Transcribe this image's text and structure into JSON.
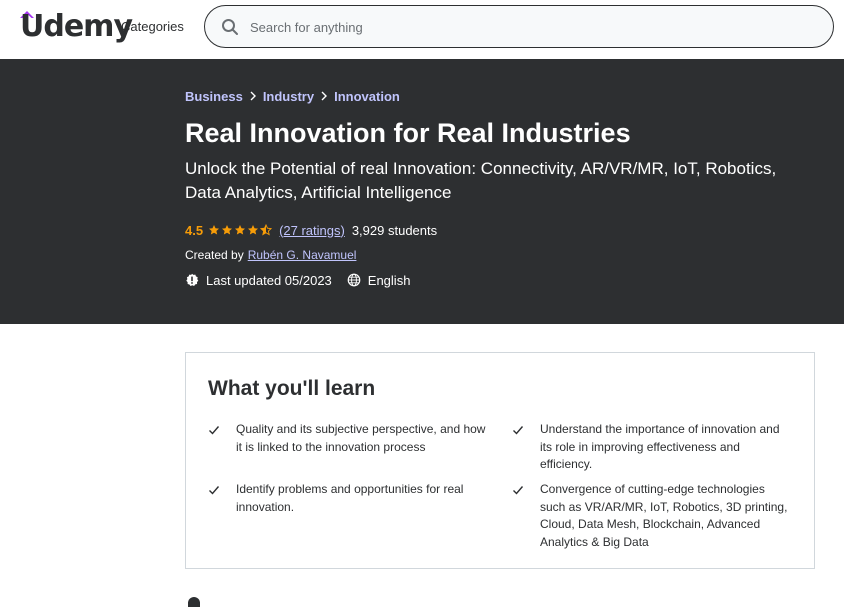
{
  "brand": {
    "name": "Udemy",
    "accent_color": "#a435f0"
  },
  "header": {
    "categories_label": "Categories",
    "search": {
      "placeholder": "Search for anything",
      "value": ""
    }
  },
  "course": {
    "breadcrumbs": [
      "Business",
      "Industry",
      "Innovation"
    ],
    "title": "Real Innovation for Real Industries",
    "subtitle": "Unlock the Potential of real Innovation: Connectivity, AR/VR/MR, IoT, Robotics, Data Analytics, Artificial Intelligence",
    "rating": "4.5",
    "rating_stars_value": 4.5,
    "ratings_count": "(27 ratings)",
    "students": "3,929 students",
    "created_by_label": "Created by",
    "creator": "Rubén G. Navamuel",
    "last_updated": "Last updated 05/2023",
    "language": "English"
  },
  "learn": {
    "title": "What you'll learn",
    "items": [
      "Quality and its subjective perspective, and how it is linked to the innovation process",
      "Understand the importance of innovation and its role in improving effectiveness and efficiency.",
      "Identify problems and opportunities for real innovation.",
      "Convergence of cutting-edge technologies such as VR/AR/MR, IoT, Robotics, 3D printing, Cloud, Data Mesh, Blockchain, Advanced Analytics & Big Data"
    ]
  },
  "colors": {
    "hero_background": "#2d2f31",
    "link": "#c0c4fc",
    "rating": "#f69c08",
    "text": "#2d2f31",
    "border": "#d1d7dc"
  },
  "icons": {
    "search": "search-icon",
    "chevron": "chevron-right-icon",
    "star": "star-icon",
    "update": "alert-badge-icon",
    "language": "globe-icon",
    "check": "check-icon"
  }
}
